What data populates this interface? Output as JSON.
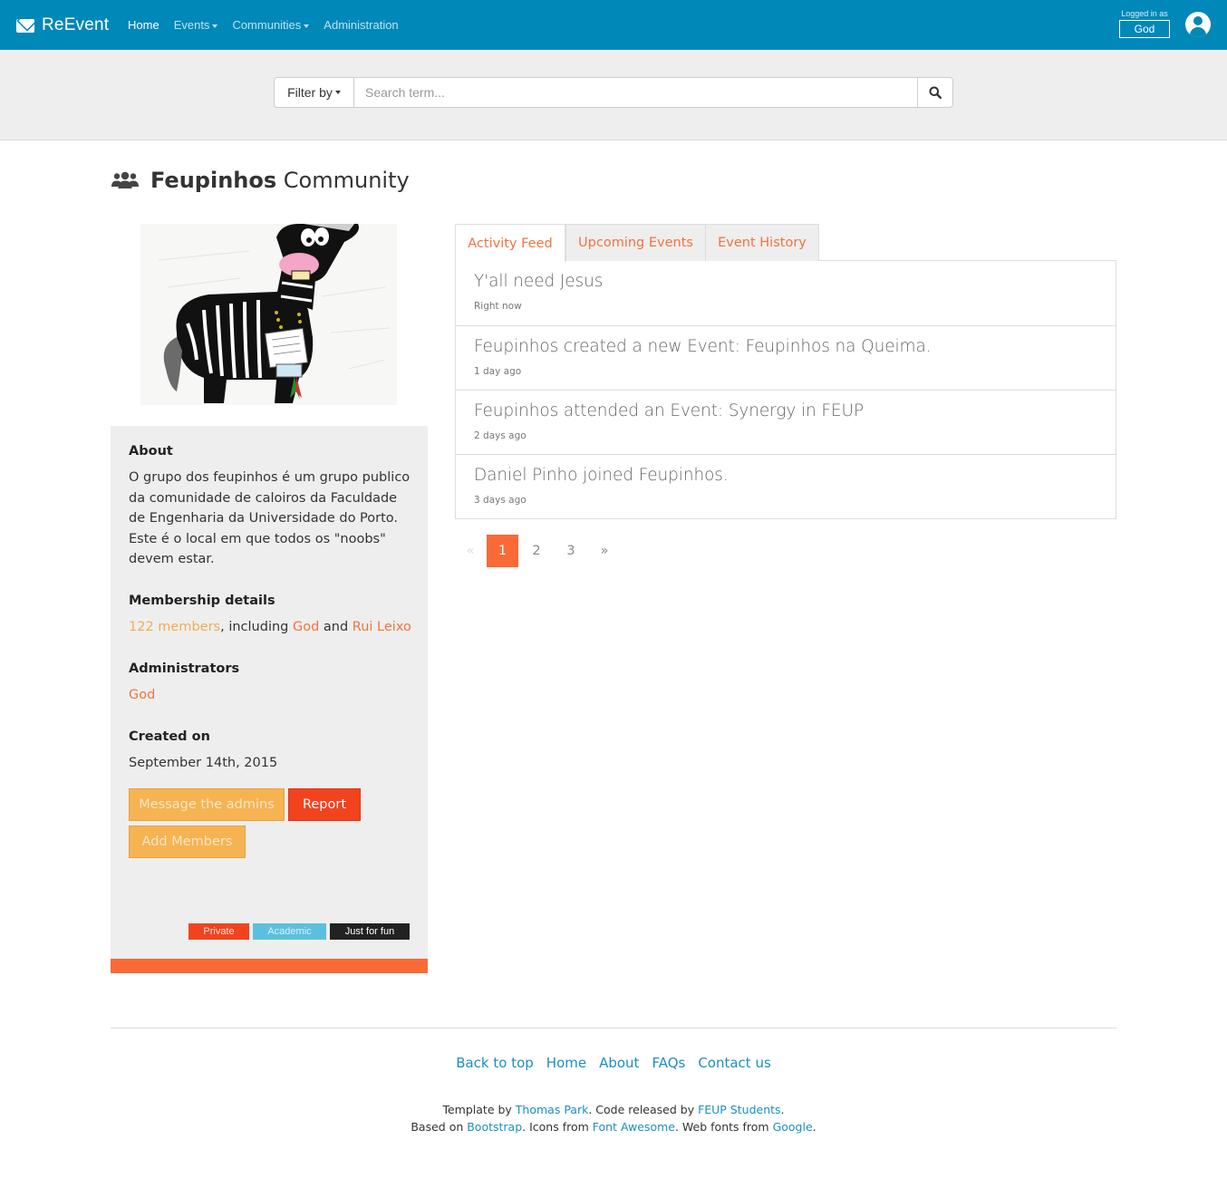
{
  "navbar": {
    "brand": "ReEvent",
    "links": [
      "Home",
      "Events",
      "Communities",
      "Administration"
    ],
    "logged_label": "Logged in as",
    "username": "God"
  },
  "search": {
    "filter_label": "Filter by",
    "placeholder": "Search term..."
  },
  "page": {
    "title_bold": "Feupinhos",
    "title_rest": "Community"
  },
  "about": {
    "heading": "About",
    "text": "O grupo dos feupinhos é um grupo publico da comunidade de caloiros da Faculdade de Engenharia da Universidade do Porto. Este é o local em que todos os \"noobs\" devem estar."
  },
  "membership": {
    "heading": "Membership details",
    "members_link": "122 members",
    "including": ", including ",
    "member_1": "God",
    "and": " and ",
    "member_2": "Rui Leixo"
  },
  "administrators": {
    "heading": "Administrators",
    "admin": "God"
  },
  "created": {
    "heading": "Created on",
    "date": "September 14th, 2015"
  },
  "buttons": {
    "message_admins": "Message the admins",
    "report": "Report",
    "add_members": "Add Members"
  },
  "tags": [
    {
      "label": "Private",
      "color": "#f2431f"
    },
    {
      "label": "Academic",
      "color": "#5bc0de"
    },
    {
      "label": "Just for fun",
      "color": "#222222"
    }
  ],
  "tabs": [
    "Activity Feed",
    "Upcoming Events",
    "Event History"
  ],
  "feed": [
    {
      "title": "Y'all need Jesus",
      "time": "Right now"
    },
    {
      "title": "Feupinhos created a new Event: Feupinhos na Queima.",
      "time": "1 day ago"
    },
    {
      "title": "Feupinhos attended an Event: Synergy in FEUP",
      "time": "2 days ago"
    },
    {
      "title": "Daniel Pinho joined Feupinhos.",
      "time": "3 days ago"
    }
  ],
  "pagination": {
    "prev": "«",
    "pages": [
      "1",
      "2",
      "3"
    ],
    "next": "»",
    "current": "1"
  },
  "footer": {
    "links": [
      "Back to top",
      "Home",
      "About",
      "FAQs",
      "Contact us"
    ],
    "template_by": "Template by ",
    "thomas_park": "Thomas Park",
    "code_released": ". Code released by ",
    "feup_students": "FEUP Students",
    "period": ".",
    "based_on": "Based on ",
    "bootstrap": "Bootstrap",
    "icons_from": ". Icons from ",
    "font_awesome": "Font Awesome",
    "web_fonts": ". Web fonts from ",
    "google": "Google",
    "end": "."
  },
  "colors": {
    "navbar": "#0088b9",
    "accent": "#f96a37",
    "warning": "#f6b351",
    "danger": "#f2431f",
    "link": "#1a8fc3"
  }
}
